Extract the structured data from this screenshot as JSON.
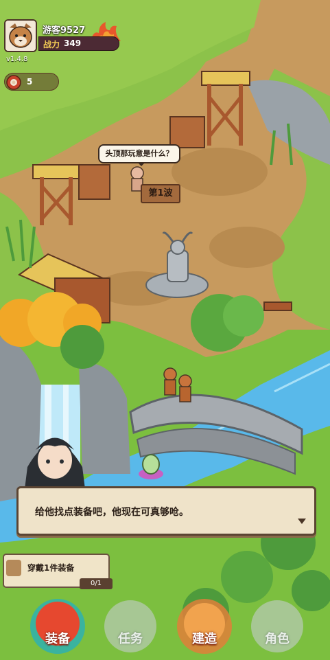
{
  "player": {
    "name": "游客9527",
    "power_label": "战力",
    "power_value": "349",
    "version": "v1.4.8",
    "meat_count": "5"
  },
  "world": {
    "speech_bubble": "头顶那玩意是什么？",
    "wave_sign": "第1波"
  },
  "dialog": {
    "text": "给他找点装备吧，他现在可真够呛。"
  },
  "quest": {
    "text": "穿戴1件装备",
    "progress": "0/1"
  },
  "nav": {
    "equip": "装备",
    "task": "任务",
    "build": "建造",
    "role": "角色"
  },
  "colors": {
    "dirt": "#c79a5e",
    "grass": "#7cbf3f",
    "river": "#59b9ea",
    "power_label": "#f4cc55",
    "dialog_bg": "#efe3c9"
  }
}
